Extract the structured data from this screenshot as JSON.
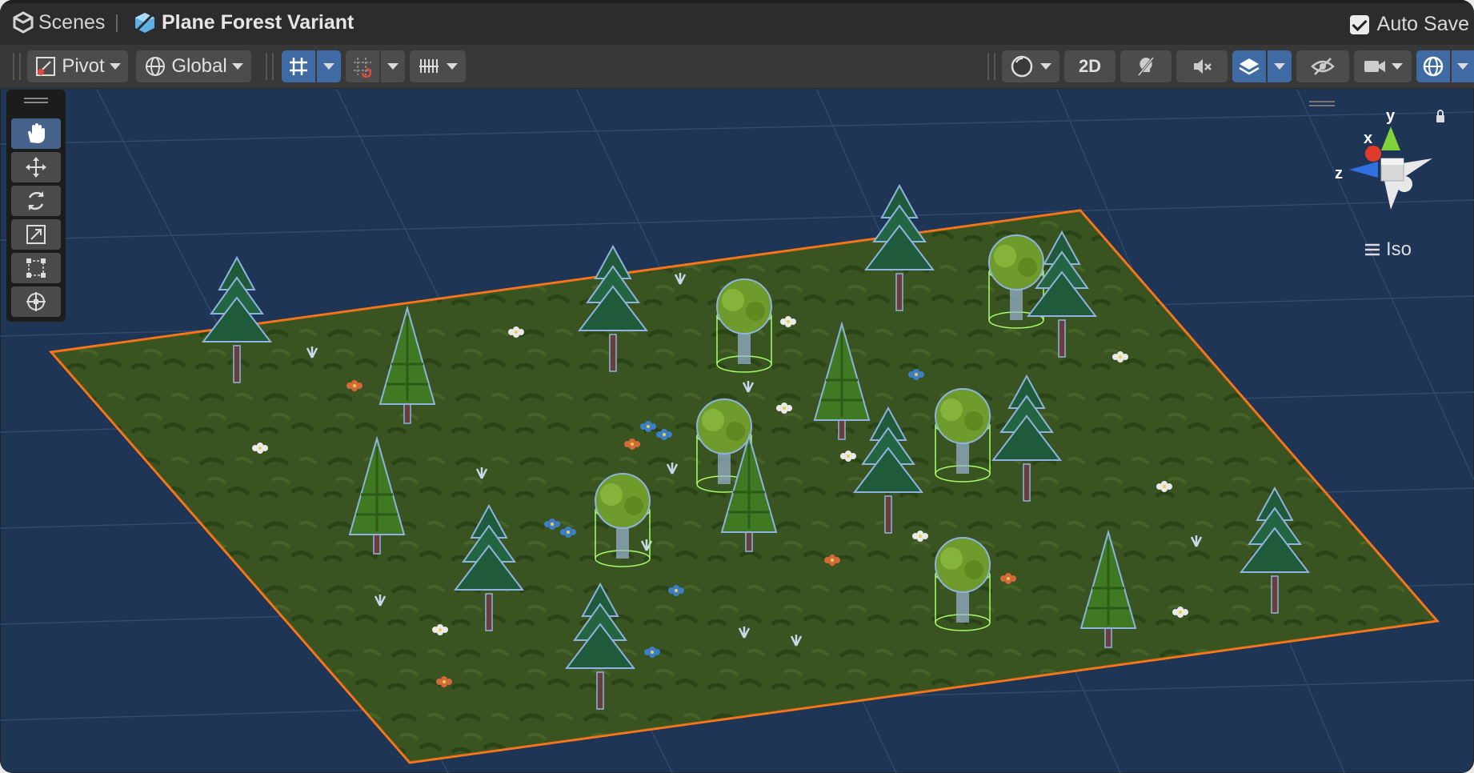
{
  "window": {
    "breadcrumb": {
      "root": "Scenes",
      "current": "Plane Forest Variant"
    },
    "auto_save": {
      "label": "Auto Save",
      "checked": true
    }
  },
  "toolbar": {
    "pivot_label": "Pivot",
    "global_label": "Global",
    "two_d_label": "2D"
  },
  "tools": [
    "hand-tool",
    "move-tool",
    "rotate-tool",
    "scale-tool",
    "rect-tool",
    "transform-tool"
  ],
  "scene": {
    "projection_label": "Iso",
    "axis_labels": {
      "x": "x",
      "y": "y",
      "z": "z"
    },
    "colors": {
      "background": "#1f3555",
      "ground": "#3d5a22",
      "selection_outline": "#ff7a1a",
      "grid": "#2e4a6c"
    }
  }
}
